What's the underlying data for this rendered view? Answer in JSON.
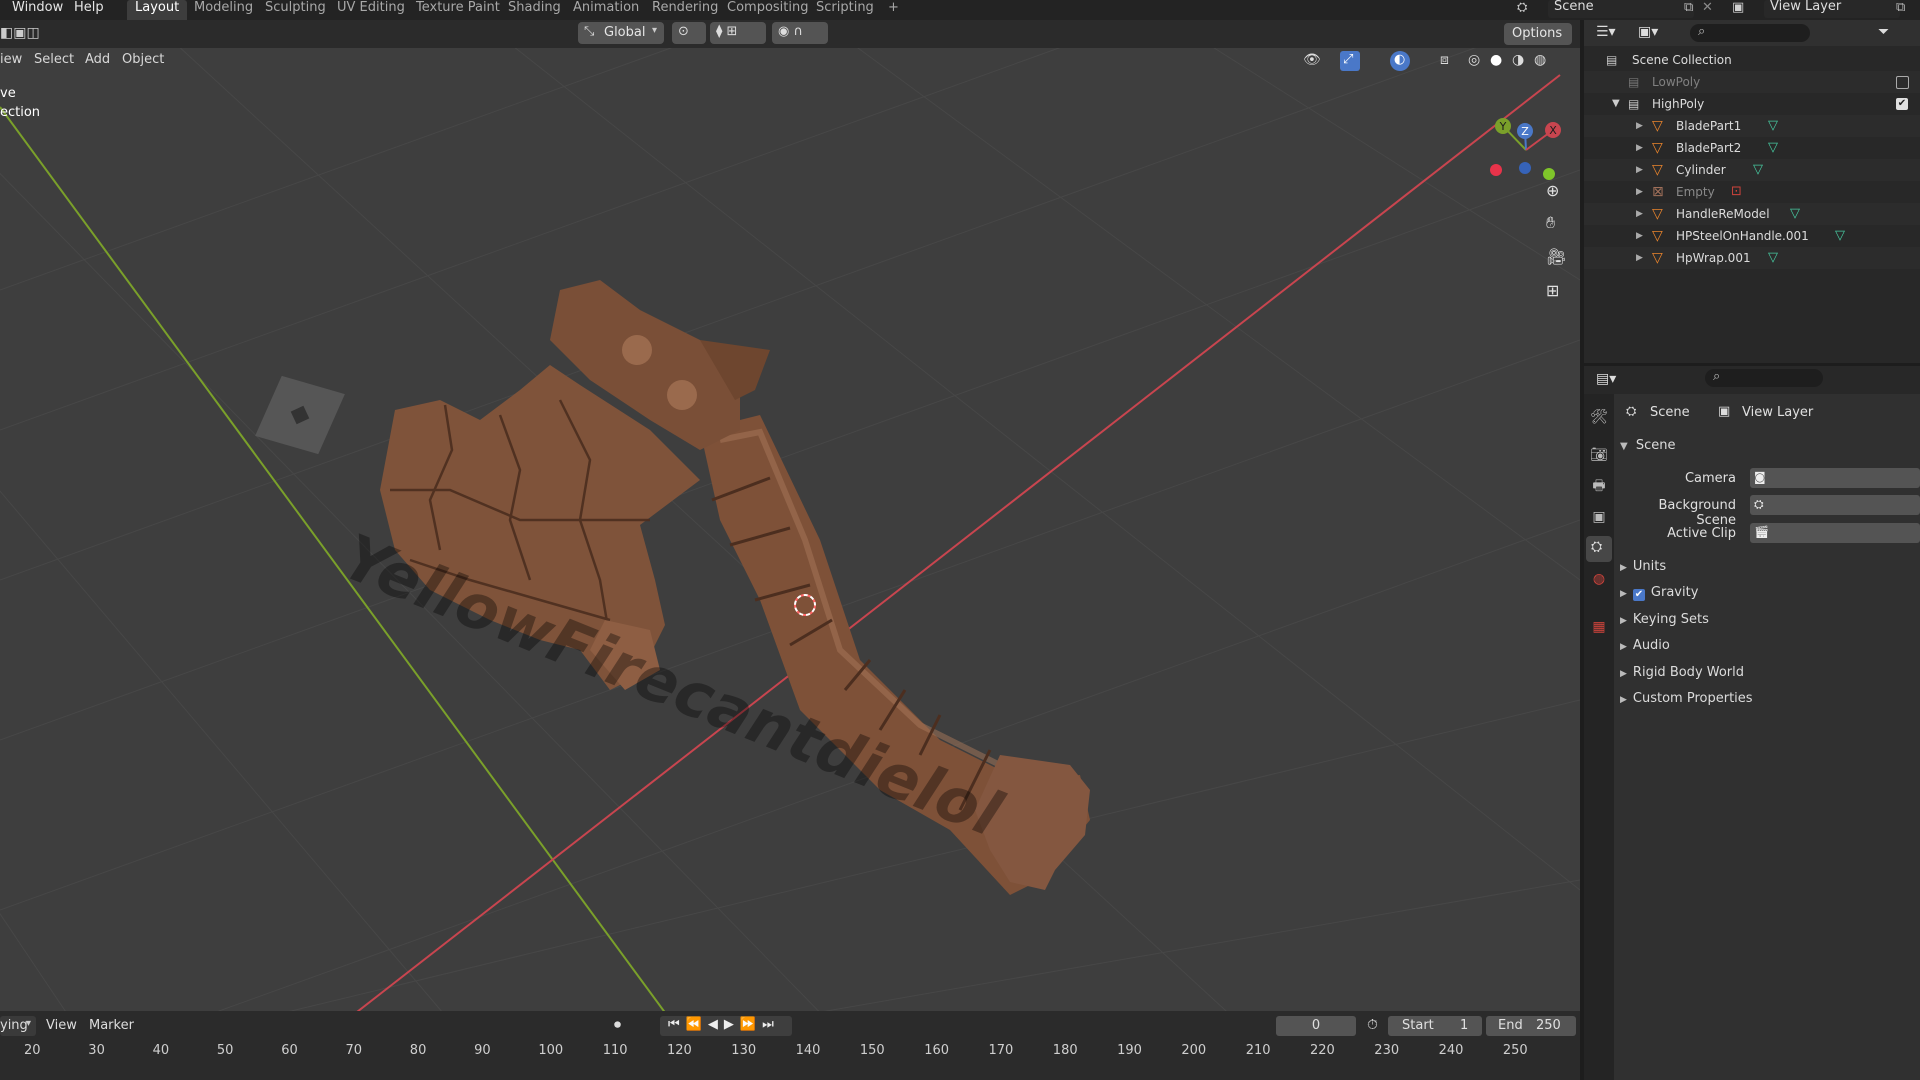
{
  "topbar": {
    "menus": [
      "Window",
      "Help"
    ],
    "workspaces": [
      "Layout",
      "Modeling",
      "Sculpting",
      "UV Editing",
      "Texture Paint",
      "Shading",
      "Animation",
      "Rendering",
      "Compositing",
      "Scripting"
    ],
    "active_workspace": "Layout",
    "add_tab": "+",
    "scene_name": "Scene",
    "view_layer_name": "View Layer"
  },
  "viewport_header": {
    "menus": [
      "iew",
      "Select",
      "Add",
      "Object"
    ],
    "transform_orientation": "Global",
    "options_label": "Options"
  },
  "viewport_overlay_text": {
    "line1": "ve",
    "line2": "ection"
  },
  "viewport_watermark": "YellowFirecantdielol",
  "gizmo": {
    "y": "Y",
    "z": "Z",
    "x": "X"
  },
  "outliner": {
    "root": "Scene Collection",
    "collections": [
      {
        "name": "LowPoly",
        "enabled": false
      },
      {
        "name": "HighPoly",
        "enabled": true
      }
    ],
    "objects": [
      "BladePart1",
      "BladePart2",
      "Cylinder",
      "Empty",
      "HandleReModel",
      "HPSteelOnHandle.001",
      "HpWrap.001"
    ]
  },
  "properties": {
    "breadcrumb_scene": "Scene",
    "breadcrumb_layer": "View Layer",
    "panel_title": "Scene",
    "fields": [
      {
        "label": "Camera"
      },
      {
        "label": "Background Scene"
      },
      {
        "label": "Active Clip"
      }
    ],
    "sections": [
      "Units",
      "Gravity",
      "Keying Sets",
      "Audio",
      "Rigid Body World",
      "Custom Properties"
    ],
    "gravity_checked": true
  },
  "timeline": {
    "mode": "ying",
    "menus": [
      "View",
      "Marker"
    ],
    "current_frame": "0",
    "start_label": "Start",
    "start_value": "1",
    "end_label": "End",
    "end_value": "250",
    "ruler": [
      "20",
      "30",
      "40",
      "50",
      "60",
      "70",
      "80",
      "90",
      "100",
      "110",
      "120",
      "130",
      "140",
      "150",
      "160",
      "170",
      "180",
      "190",
      "200",
      "210",
      "220",
      "230",
      "240",
      "250"
    ]
  },
  "colors": {
    "x_axis": "#c8454f",
    "y_axis": "#7aa02a",
    "z_axis": "#4a78c8",
    "object_orange": "#e8842c",
    "mesh_green": "#47c9a0",
    "axe_brown": "#8a5a3e"
  }
}
